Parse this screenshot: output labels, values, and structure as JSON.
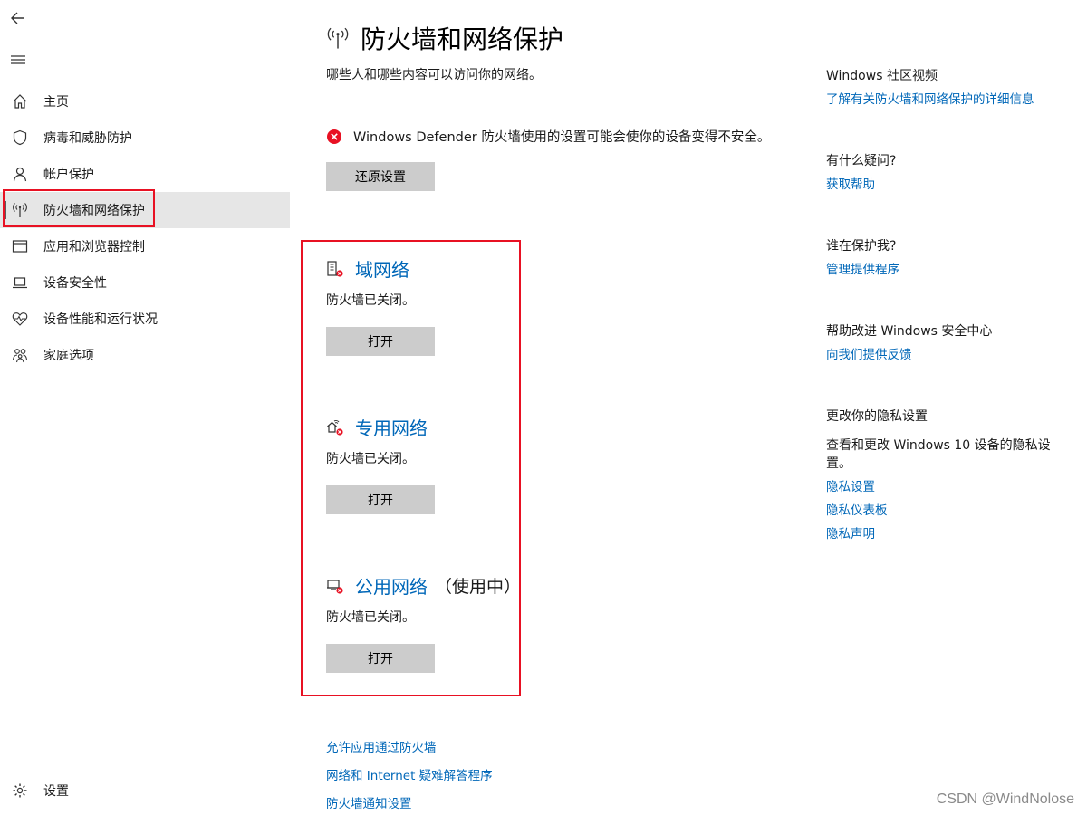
{
  "nav": {
    "back_icon": "back-arrow-icon",
    "menu_icon": "hamburger-icon",
    "items": [
      {
        "label": "主页",
        "icon": "home-icon"
      },
      {
        "label": "病毒和威胁防护",
        "icon": "shield-icon"
      },
      {
        "label": "帐户保护",
        "icon": "person-icon"
      },
      {
        "label": "防火墙和网络保护",
        "icon": "antenna-icon",
        "active": true
      },
      {
        "label": "应用和浏览器控制",
        "icon": "browser-window-icon"
      },
      {
        "label": "设备安全性",
        "icon": "laptop-icon"
      },
      {
        "label": "设备性能和运行状况",
        "icon": "heart-pulse-icon"
      },
      {
        "label": "家庭选项",
        "icon": "family-icon"
      }
    ],
    "settings_label": "设置"
  },
  "main": {
    "title": "防火墙和网络保护",
    "subtitle": "哪些人和哪些内容可以访问你的网络。",
    "warning_text": "Windows Defender 防火墙使用的设置可能会使你的设备变得不安全。",
    "restore_button": "还原设置",
    "networks": [
      {
        "name": "域网络",
        "extra": "",
        "status": "防火墙已关闭。",
        "button": "打开",
        "icon": "domain-network-icon"
      },
      {
        "name": "专用网络",
        "extra": "",
        "status": "防火墙已关闭。",
        "button": "打开",
        "icon": "private-network-icon"
      },
      {
        "name": "公用网络",
        "extra": "（使用中）",
        "status": "防火墙已关闭。",
        "button": "打开",
        "icon": "public-network-icon"
      }
    ],
    "links": [
      "允许应用通过防火墙",
      "网络和 Internet 疑难解答程序",
      "防火墙通知设置"
    ]
  },
  "right": {
    "community": {
      "title": "Windows 社区视频",
      "link": "了解有关防火墙和网络保护的详细信息"
    },
    "question": {
      "title": "有什么疑问?",
      "link": "获取帮助"
    },
    "protector": {
      "title": "谁在保护我?",
      "link": "管理提供程序"
    },
    "improve": {
      "title": "帮助改进 Windows 安全中心",
      "link": "向我们提供反馈"
    },
    "privacy": {
      "title": "更改你的隐私设置",
      "text": "查看和更改 Windows 10 设备的隐私设置。",
      "links": [
        "隐私设置",
        "隐私仪表板",
        "隐私声明"
      ]
    }
  },
  "watermark": "CSDN @WindNolose",
  "colors": {
    "accent": "#0067b8",
    "error": "#e81123",
    "button": "#cccccc",
    "active_bg": "#e6e6e6"
  }
}
